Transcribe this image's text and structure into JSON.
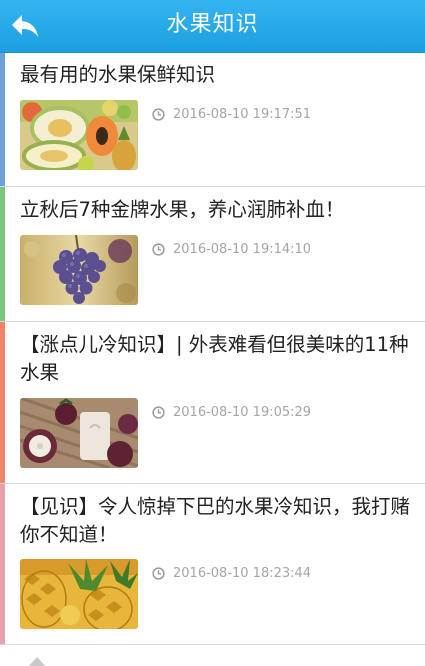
{
  "header": {
    "title": "水果知识"
  },
  "articles": [
    {
      "title": "最有用的水果保鲜知识",
      "time": "2016-08-10 19:17:51",
      "accent": "#6aa3d8"
    },
    {
      "title": "立秋后7种金牌水果，养心润肺补血！",
      "time": "2016-08-10 19:14:10",
      "accent": "#79c77d"
    },
    {
      "title": "【涨点儿冷知识】| 外表难看但很美味的11种水果",
      "time": "2016-08-10 19:05:29",
      "accent": "#ef8468"
    },
    {
      "title": "【见识】令人惊掉下巴的水果冷知识，我打赌你不知道！",
      "time": "2016-08-10 18:23:44",
      "accent": "#e7a1ad"
    }
  ],
  "icons": {
    "back": "back-arrow-icon",
    "clock": "clock-icon"
  },
  "colors": {
    "header": "#27aae8",
    "meta_text": "#a5a5a5"
  }
}
